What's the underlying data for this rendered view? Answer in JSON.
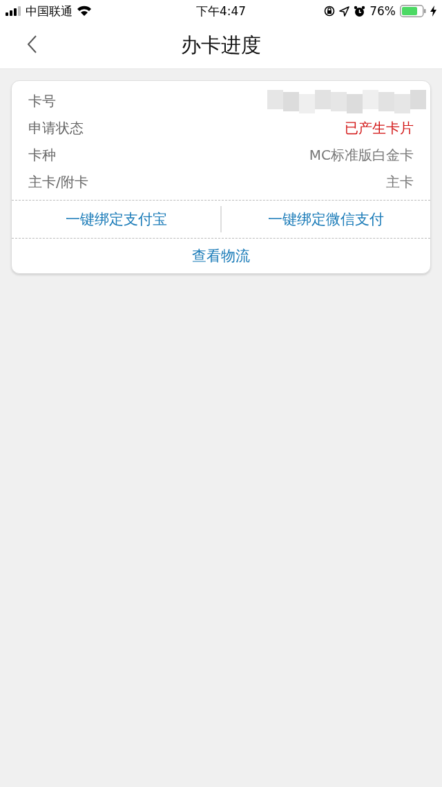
{
  "status_bar": {
    "carrier": "中国联通",
    "time": "下午4:47",
    "battery_percent": "76%"
  },
  "nav": {
    "title": "办卡进度"
  },
  "card": {
    "rows": [
      {
        "label": "卡号",
        "kind": "redacted"
      },
      {
        "label": "申请状态",
        "kind": "status",
        "value": "已产生卡片"
      },
      {
        "label": "卡种",
        "kind": "text",
        "value": "MC标准版白金卡"
      },
      {
        "label": "主卡/附卡",
        "kind": "text",
        "value": "主卡"
      }
    ],
    "bind_buttons": [
      "一键绑定支付宝",
      "一键绑定微信支付"
    ],
    "logistics_link": "查看物流"
  }
}
